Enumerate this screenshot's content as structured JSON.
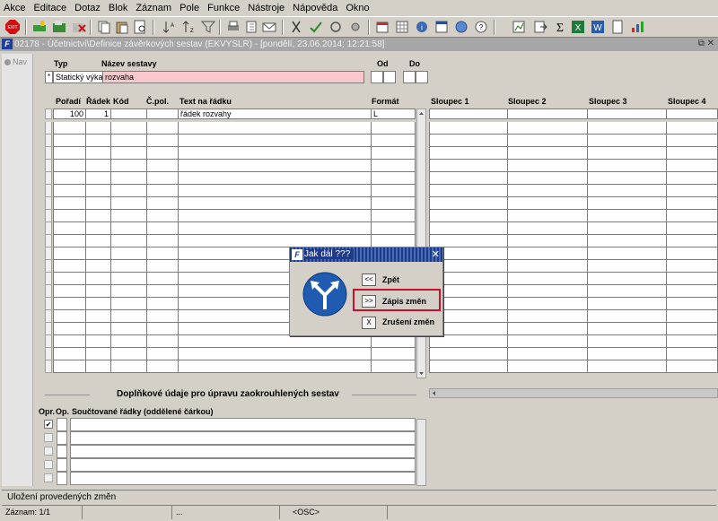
{
  "menu": [
    "Akce",
    "Editace",
    "Dotaz",
    "Blok",
    "Záznam",
    "Pole",
    "Funkce",
    "Nástroje",
    "Nápověda",
    "Okno"
  ],
  "toolbar": {
    "exit_label": "EXIT",
    "icons": [
      "exit-icon",
      "insert-record-icon",
      "save-icon",
      "delete-record-icon",
      "copy-icon",
      "paste-icon",
      "print-icon",
      "sort-asc-icon",
      "sort-desc-icon",
      "filter-icon",
      "printer-icon",
      "attach-icon",
      "mail-icon",
      "cut-icon",
      "spellcheck-icon",
      "refresh-icon",
      "calculator-icon",
      "sum-icon",
      "excel-icon",
      "word-icon",
      "export-icon",
      "chart-icon"
    ]
  },
  "window": {
    "title": "02178 - Účetnictví\\Definice závěrkových sestav (EKVYSLR) - [pondělí, 23.06.2014; 12:21:58]",
    "logo": "F",
    "controls": "⧉ ✕",
    "nav_label": "Nav"
  },
  "header": {
    "typ_label": "Typ",
    "nazev_label": "Název sestavy",
    "od_label": "Od",
    "do_label": "Do",
    "star": "*",
    "typ_value": "Statický výka",
    "nazev_value": "rozvaha"
  },
  "grid": {
    "columns": [
      "Pořadí",
      "Řádek",
      "Kód",
      "Č.pol.",
      "Text na řádku",
      "Formát",
      "Sloupec 1",
      "Sloupec 2",
      "Sloupec 3",
      "Sloupec 4"
    ],
    "rows": [
      {
        "poradi": "100",
        "radek": "1",
        "kod": "",
        "cpol": "",
        "text": "řádek rozvahy",
        "format": "L"
      }
    ]
  },
  "extra": {
    "section_title": "Doplňkové údaje pro úpravu zaokrouhlených sestav",
    "col_opr": "Opr.",
    "col_op": "Op.",
    "col_rows": "Součtované řádky (oddělené čárkou)",
    "checkbox_checked": true,
    "checkmark": "✔"
  },
  "dialog": {
    "title": "Jak dál ???",
    "logo": "F",
    "close": "✕",
    "buttons": [
      {
        "key": "<<",
        "label": "Zpět"
      },
      {
        "key": ">>",
        "label": "Zápis změn"
      },
      {
        "key": "X",
        "label": "Zrušení změn"
      }
    ]
  },
  "status": {
    "message": "Uložení provedených změn",
    "record": "Záznam: 1/1",
    "cell2": "...",
    "osc": "<OSC>"
  },
  "colors": {
    "pink_field": "#f8c8cc",
    "selected_row": "#c2def8",
    "highlight": "#c8102e",
    "sign_blue": "#1f5bb0"
  }
}
